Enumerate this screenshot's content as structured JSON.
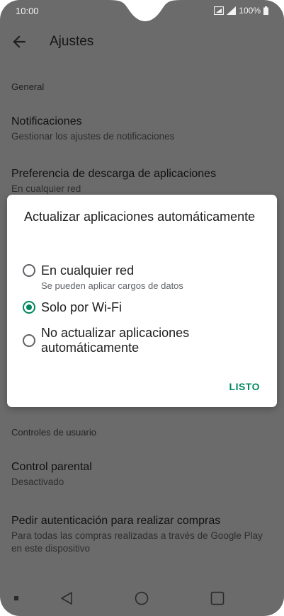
{
  "status_bar": {
    "time": "10:00",
    "battery": "100%"
  },
  "app_bar": {
    "back_icon": "arrow-back-icon",
    "title": "Ajustes"
  },
  "settings": {
    "general_header": "General",
    "notifications": {
      "title": "Notificaciones",
      "subtitle": "Gestionar los ajustes de notificaciones"
    },
    "download_pref": {
      "title": "Preferencia de descarga de aplicaciones",
      "subtitle": "En cualquier red"
    },
    "user_controls_header": "Controles de usuario",
    "parental": {
      "title": "Control parental",
      "subtitle": "Desactivado"
    },
    "auth": {
      "title": "Pedir autenticación para realizar compras",
      "subtitle": "Para todas las compras realizadas a través de Google Play en este dispositivo"
    }
  },
  "dialog": {
    "title": "Actualizar aplicaciones automáticamente",
    "options": [
      {
        "label": "En cualquier red",
        "sub": "Se pueden aplicar cargos de datos",
        "selected": false
      },
      {
        "label": "Solo por Wi-Fi",
        "sub": "",
        "selected": true
      },
      {
        "label": "No actualizar aplicaciones automáticamente",
        "sub": "",
        "selected": false
      }
    ],
    "done_label": "LISTO",
    "accent_color": "#01875f"
  },
  "nav_bar": {
    "icons": [
      "square-small-icon",
      "back-triangle-icon",
      "home-circle-icon",
      "recents-square-icon"
    ]
  }
}
